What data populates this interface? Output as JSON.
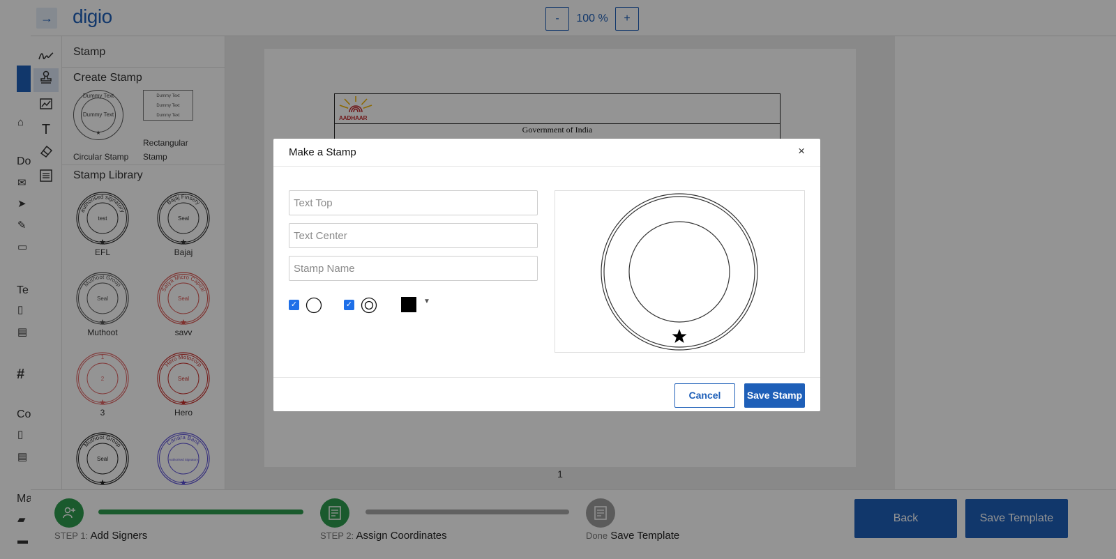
{
  "background_app": {
    "labels": [
      "Do",
      "Te",
      "#",
      "Co",
      "Ma"
    ]
  },
  "editor": {
    "expand_icon": "→",
    "logo": "digio",
    "zoom": {
      "minus": "-",
      "level": "100 %",
      "plus": "+"
    },
    "panel": {
      "title": "Stamp",
      "create_title": "Create Stamp",
      "create_items": [
        {
          "label": "Circular Stamp",
          "dummy_top": "Dummy Text",
          "dummy_center": "Dummy Text"
        },
        {
          "label_line1": "Rectangular",
          "label_line2": "Stamp",
          "dummy_lines": [
            "Dummy Text",
            "Dummy Text",
            "Dummy Text"
          ]
        }
      ],
      "library_title": "Stamp Library",
      "library": [
        {
          "name": "EFL",
          "top": "authorised signatory",
          "center": "test",
          "color": "#333333"
        },
        {
          "name": "Bajaj",
          "top": "Bajaj Finsery",
          "center": "Seal",
          "color": "#333333"
        },
        {
          "name": "Muthoot",
          "top": "Muthoot Group",
          "center": "Seal",
          "color": "#555555"
        },
        {
          "name": "savv",
          "top": "Satya Micro Capital",
          "center": "Seal",
          "color": "#d9534f"
        },
        {
          "name": "3",
          "top": "1",
          "center": "2",
          "color": "#e06666"
        },
        {
          "name": "Hero",
          "top": "Hero Motocorp",
          "center": "Seal",
          "color": "#c9302c"
        },
        {
          "name": "",
          "top": "Muthoot Group",
          "center": "Seal",
          "color": "#222222"
        },
        {
          "name": "",
          "top": "Canara Bank",
          "center": "Authorised Signatory",
          "color": "#5b4fd6"
        }
      ]
    },
    "document": {
      "logo_text": "AADHAAR",
      "line1": "Government of India",
      "page_number": "1"
    },
    "steps": [
      {
        "prefix": "STEP 1:",
        "label": "Add Signers",
        "color": "#2e9b4e"
      },
      {
        "prefix": "STEP 2:",
        "label": "Assign Coordinates",
        "color": "#2e9b4e"
      },
      {
        "prefix": "Done",
        "label": "Save Template",
        "color": "#9e9e9e"
      }
    ],
    "back_label": "Back",
    "save_template_label": "Save Template"
  },
  "modal": {
    "title": "Make a Stamp",
    "close": "×",
    "fields": {
      "text_top": {
        "value": "",
        "placeholder": "Text Top"
      },
      "text_center": {
        "value": "",
        "placeholder": "Text Center"
      },
      "stamp_name": {
        "value": "",
        "placeholder": "Stamp Name"
      }
    },
    "options": {
      "single_ring_checked": true,
      "double_ring_checked": true,
      "color": "#000000"
    },
    "cancel_label": "Cancel",
    "save_label": "Save Stamp"
  },
  "colors": {
    "brand": "#1e5fb8",
    "step_done": "#2e9b4e",
    "step_pending": "#9e9e9e"
  }
}
